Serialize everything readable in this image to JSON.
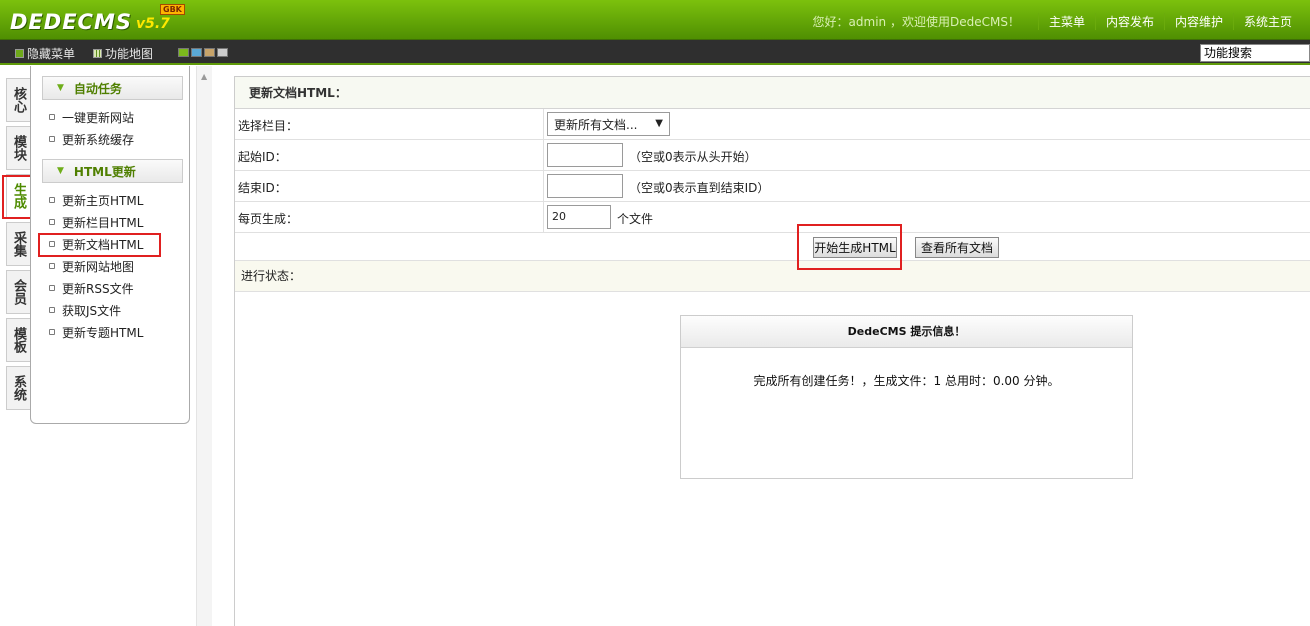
{
  "app": {
    "logo_name": "DEDECMS",
    "logo_version": "v5.7",
    "logo_badge": "GBK"
  },
  "header": {
    "welcome": "您好：admin ，欢迎使用DedeCMS！",
    "nav": [
      "主菜单",
      "内容发布",
      "内容维护",
      "系统主页"
    ]
  },
  "toolbar": {
    "hide_menu": "隐藏菜单",
    "func_map": "功能地图",
    "search_placeholder": "功能搜索",
    "skin_colors": [
      "#7bb81c",
      "#5aa9d6",
      "#c8a46a",
      "#cccccc"
    ]
  },
  "side_tabs": [
    "核心",
    "模块",
    "生成",
    "采集",
    "会员",
    "模板",
    "系统"
  ],
  "side_tab_active": "生成",
  "menu": {
    "group1_title": "自动任务",
    "group1_items": [
      "一键更新网站",
      "更新系统缓存"
    ],
    "group2_title": "HTML更新",
    "group2_items": [
      "更新主页HTML",
      "更新栏目HTML",
      "更新文档HTML",
      "更新网站地图",
      "更新RSS文件",
      "获取JS文件",
      "更新专题HTML"
    ]
  },
  "form": {
    "title": "更新文档HTML：",
    "select_label": "选择栏目：",
    "select_value": "更新所有文档...",
    "start_label": "起始ID：",
    "start_value": "",
    "start_hint": "（空或0表示从头开始）",
    "end_label": "结束ID：",
    "end_value": "",
    "end_hint": "（空或0表示直到结束ID）",
    "per_page_label": "每页生成：",
    "per_page_value": "20",
    "per_page_unit": "个文件",
    "start_button": "开始生成HTML",
    "view_button": "查看所有文档",
    "status_label": "进行状态："
  },
  "notice": {
    "title": "DedeCMS 提示信息！",
    "message": "完成所有创建任务！，生成文件：1 总用时：0.00 分钟。"
  }
}
